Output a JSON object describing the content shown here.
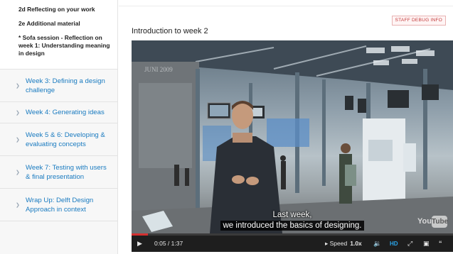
{
  "sidebar": {
    "sub_items": [
      {
        "label": "2d Reflecting on your work"
      },
      {
        "label": "2e Additional material"
      },
      {
        "label": "* Sofa session - Reflection on week 1: Understanding meaning in design"
      }
    ],
    "weeks": [
      {
        "label": "Week 3: Defining a design challenge"
      },
      {
        "label": "Week 4: Generating ideas"
      },
      {
        "label": "Week 5 & 6: Developing & evaluating concepts"
      },
      {
        "label": "Week 7: Testing with users & final presentation"
      },
      {
        "label": "Wrap Up: Delft Design Approach in context"
      }
    ]
  },
  "main": {
    "debug_label": "STAFF DEBUG INFO",
    "video_title": "Introduction to week 2"
  },
  "video": {
    "scene_text": "JUNI 2009",
    "captions": [
      "Last week,",
      "we introduced the basics of designing."
    ],
    "watermark_you": "You",
    "watermark_tube": "Tube",
    "progress_fraction": 0.05,
    "controls": {
      "play_icon": "play-icon",
      "time": "0:05 / 1:37",
      "speed_label": "Speed",
      "speed_value": "1.0x",
      "hd_label": "HD"
    }
  },
  "colors": {
    "link": "#1a7bc0",
    "debug": "#c23b3b",
    "hd": "#2aa3e8",
    "progress": "#d42f2f"
  }
}
